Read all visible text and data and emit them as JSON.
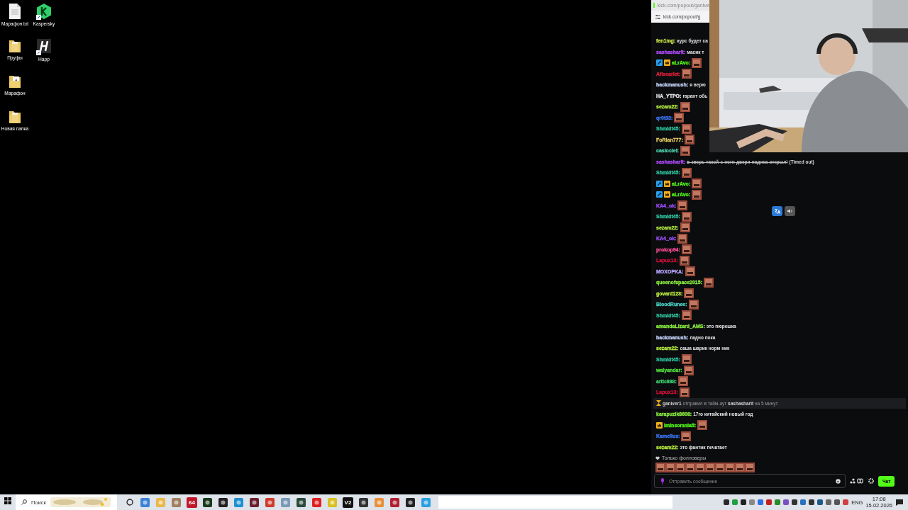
{
  "desktop": {
    "icons": [
      {
        "kind": "file",
        "label": "Марафон.txt"
      },
      {
        "kind": "hexagon",
        "label": "Kaspersky"
      },
      {
        "kind": "folder",
        "label": "Пруфы"
      },
      {
        "kind": "dark-app",
        "label": "Happ"
      },
      {
        "kind": "folder-doc",
        "label": "Марафон"
      },
      {
        "kind": "folder",
        "label": "Новая папка"
      }
    ]
  },
  "popout": {
    "tab_title": "kick.com/popout/gantve",
    "address": "kick.com/popout/g"
  },
  "chat": {
    "messages": [
      {
        "kind": "message",
        "user": "fen1mg:",
        "color": "#c8e04a",
        "text": "курс будет са"
      },
      {
        "kind": "message",
        "user": "sashasharit:",
        "color": "#b04dff",
        "text": "масик т"
      },
      {
        "kind": "message",
        "badges": [
          {
            "kind": "mod"
          },
          {
            "kind": "crown"
          }
        ],
        "user": "aLrAvo:",
        "color": "#53fc18"
      },
      {
        "kind": "message",
        "user": "Afiscarlet:",
        "color": "#e0203a"
      },
      {
        "kind": "message",
        "user": "hackmanush:",
        "color": "#c8d8ff",
        "text": "я верю"
      },
      {
        "kind": "message",
        "user": "HA_YTPO:",
        "color": "#e8e8e8",
        "text": "гарант обь"
      },
      {
        "kind": "message",
        "user": "sezam22:",
        "color": "#b8f040"
      },
      {
        "kind": "message",
        "user": "qr0t33:",
        "color": "#3d7bff"
      },
      {
        "kind": "message",
        "user": "Shmidt45:",
        "color": "#2ec7a0"
      },
      {
        "kind": "message",
        "user": "FoRlan777:",
        "color": "#e8d060"
      },
      {
        "kind": "message",
        "user": "casiociei:",
        "color": "#4dd6b0"
      },
      {
        "kind": "message",
        "user": "sashasharit:",
        "color": "#b04dff",
        "text": "в-зверь-такой-с-ноги-двери-падика-открыл!",
        "timed_out": true,
        "note": "(Timed out)"
      },
      {
        "kind": "message",
        "user": "Shmidt45:",
        "color": "#2ec7a0"
      },
      {
        "kind": "message",
        "badges": [
          {
            "kind": "mod"
          },
          {
            "kind": "crown"
          }
        ],
        "user": "aLrAvo:",
        "color": "#53fc18"
      },
      {
        "kind": "message",
        "badges": [
          {
            "kind": "mod"
          },
          {
            "kind": "crown"
          }
        ],
        "user": "aLrAvo:",
        "color": "#53fc18"
      },
      {
        "kind": "message",
        "user": "KA4_ok:",
        "color": "#a050ff"
      },
      {
        "kind": "message",
        "user": "Shmidt45:",
        "color": "#2ec7a0"
      },
      {
        "kind": "message",
        "user": "sezam22:",
        "color": "#b8f040"
      },
      {
        "kind": "message",
        "user": "KA4_ok:",
        "color": "#a050ff"
      },
      {
        "kind": "message",
        "user": "prokop94:",
        "color": "#ff4f9a"
      },
      {
        "kind": "message",
        "user": "Lapux13:",
        "color": "#d0103a"
      },
      {
        "kind": "message",
        "user": "MOXOPKA:",
        "color": "#b9a6ff"
      },
      {
        "kind": "message",
        "user": "queenofspace2015:",
        "color": "#8cf040"
      },
      {
        "kind": "message",
        "user": "govard123:",
        "color": "#c0f040"
      },
      {
        "kind": "message",
        "user": "BloodRunee:",
        "color": "#4dd6c8"
      },
      {
        "kind": "message",
        "user": "Shmidt45:",
        "color": "#2ec7a0"
      },
      {
        "kind": "message",
        "user": "amandaLizard_AMS:",
        "color": "#8cf040",
        "text": "это пюрешка"
      },
      {
        "kind": "message",
        "user": "hackmanush:",
        "color": "#c8d8ff",
        "text": "ладно пока"
      },
      {
        "kind": "message",
        "user": "sezam22:",
        "color": "#b8f040",
        "text": "саша шарик норм ник"
      },
      {
        "kind": "message",
        "user": "Shmidt45:",
        "color": "#2ec7a0"
      },
      {
        "kind": "message",
        "user": "walyandar:",
        "color": "#53e040"
      },
      {
        "kind": "message",
        "user": "artic888:",
        "color": "#40d070"
      },
      {
        "kind": "message",
        "user": "Lapux13:",
        "color": "#d0103a"
      },
      {
        "kind": "system",
        "text": "**ganiver1** отправил в тайм-аут **sashasharit** на 5 минут"
      },
      {
        "kind": "message",
        "user": "karapuzik8608:",
        "color": "#8cf040",
        "text": "17го китайский новый год"
      },
      {
        "kind": "message",
        "badges": [
          {
            "kind": "crown"
          }
        ],
        "user": "Iminsomnia5:",
        "color": "#53fc18"
      },
      {
        "kind": "message",
        "user": "Kamelius:",
        "color": "#3d7bff"
      },
      {
        "kind": "message",
        "user": "sezam22:",
        "color": "#b8f040",
        "text": "это фантик печатает"
      }
    ],
    "followers_only": "Только фолловеры",
    "input": {
      "placeholder": "Отправить сообщение"
    },
    "send_button": "Чат"
  },
  "taskbar": {
    "search": {
      "placeholder": "Поиск"
    },
    "apps": [
      {
        "kind": "circle"
      },
      {
        "kind": "tile",
        "color": "#3b82d6"
      },
      {
        "kind": "tile",
        "color": "#e8b84a"
      },
      {
        "kind": "tile",
        "color": "#a08060"
      },
      {
        "kind": "tile",
        "color": "#c0182a",
        "label": "64"
      },
      {
        "kind": "tile",
        "color": "#1a3a1a"
      },
      {
        "kind": "tile",
        "color": "#222222"
      },
      {
        "kind": "tile",
        "color": "#1e90d0"
      },
      {
        "kind": "tile",
        "color": "#6a2030"
      },
      {
        "kind": "tile",
        "color": "#d03a2a"
      },
      {
        "kind": "tile",
        "color": "#7a9ab8"
      },
      {
        "kind": "tile",
        "color": "#2a4a3a"
      },
      {
        "kind": "tile",
        "color": "#e02020"
      },
      {
        "kind": "tile",
        "color": "#d8c020"
      },
      {
        "kind": "tile",
        "color": "#111111",
        "label": "V2"
      },
      {
        "kind": "tile",
        "color": "#333333"
      },
      {
        "kind": "tile",
        "color": "#e8903a"
      },
      {
        "kind": "tile",
        "color": "#b02030"
      },
      {
        "kind": "tile",
        "color": "#222222"
      },
      {
        "kind": "tile",
        "color": "#2aa0e0"
      }
    ],
    "language": "ENG",
    "time": "17:08",
    "date": "15.02.2026"
  }
}
